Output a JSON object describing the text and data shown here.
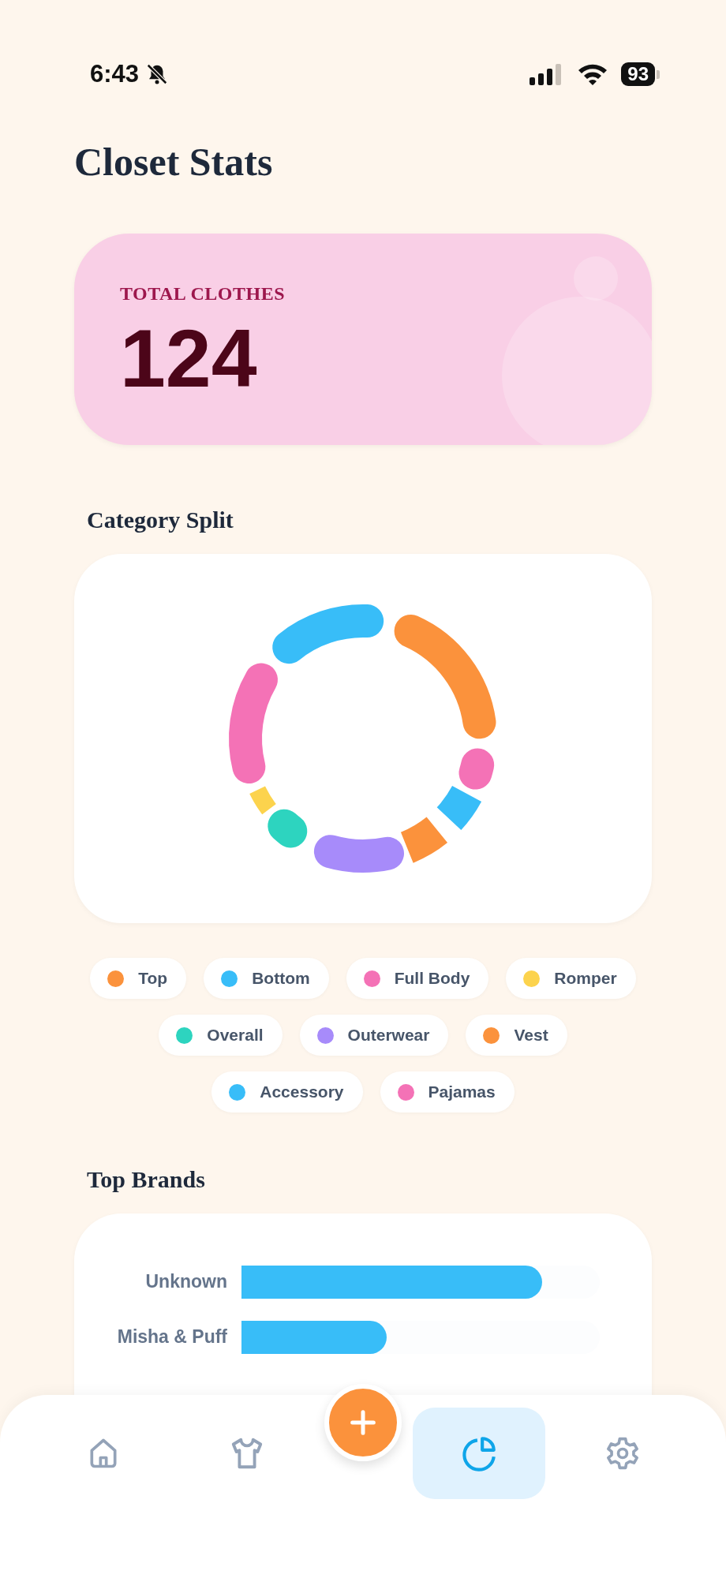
{
  "status_bar": {
    "time": "6:43",
    "battery": "93"
  },
  "title": "Closet Stats",
  "total_card": {
    "label": "TOTAL CLOTHES",
    "value": "124"
  },
  "category_split": {
    "heading": "Category Split",
    "legend": [
      {
        "label": "Top",
        "color": "#fb923c"
      },
      {
        "label": "Bottom",
        "color": "#38bdf8"
      },
      {
        "label": "Full Body",
        "color": "#f472b6"
      },
      {
        "label": "Romper",
        "color": "#fcd34d"
      },
      {
        "label": "Overall",
        "color": "#2dd4bf"
      },
      {
        "label": "Outerwear",
        "color": "#a78bfa"
      },
      {
        "label": "Vest",
        "color": "#fb923c"
      },
      {
        "label": "Accessory",
        "color": "#38bdf8"
      },
      {
        "label": "Pajamas",
        "color": "#f472b6"
      }
    ]
  },
  "top_brands": {
    "heading": "Top Brands",
    "bars": [
      {
        "name": "Unknown",
        "level": 0.84
      },
      {
        "name": "Misha & Puff",
        "level": 0.405
      }
    ]
  },
  "nav": [
    {
      "kind": "home",
      "selected": false
    },
    {
      "kind": "wardrobe",
      "selected": false
    },
    {
      "kind": "add",
      "selected": false
    },
    {
      "kind": "stats",
      "selected": true
    },
    {
      "kind": "settings",
      "selected": false
    }
  ]
}
